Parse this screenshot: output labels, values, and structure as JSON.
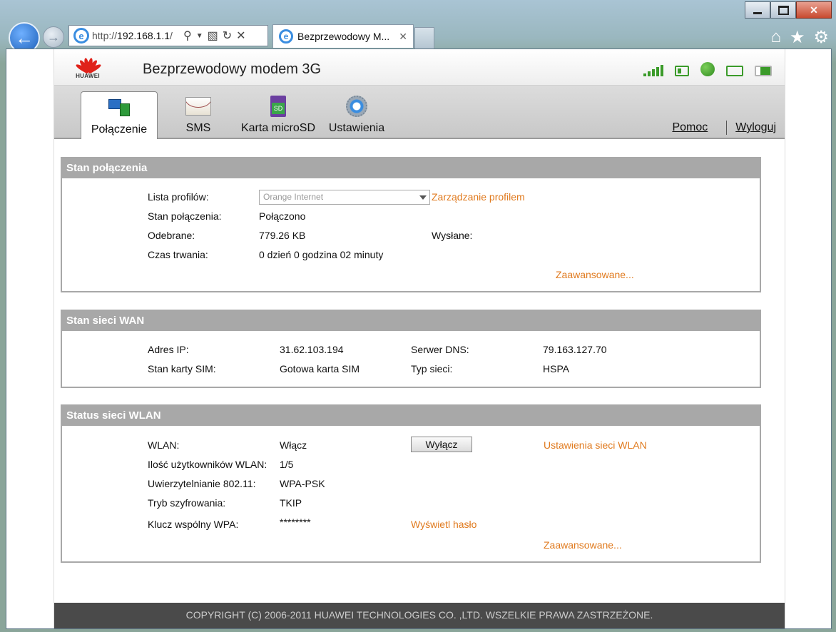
{
  "browser": {
    "url": "http://192.168.1.1/",
    "url_host": "192.168.1.1",
    "tab_title": "Bezprzewodowy M...",
    "tab_close": "✕"
  },
  "header": {
    "brand": "HUAWEI",
    "title": "Bezprzewodowy modem 3G"
  },
  "nav": {
    "tabs": [
      {
        "label": "Połączenie",
        "icon": "connection-icon",
        "active": true
      },
      {
        "label": "SMS",
        "icon": "envelope-icon"
      },
      {
        "label": "Karta microSD",
        "icon": "sd-card-icon"
      },
      {
        "label": "Ustawienia",
        "icon": "gear-icon"
      }
    ],
    "help": "Pomoc",
    "logout": "Wyloguj"
  },
  "connection": {
    "title": "Stan połączenia",
    "profile_label": "Lista profilów:",
    "profile_value": "Orange Internet",
    "profile_manage": "Zarządzanie profilem",
    "state_label": "Stan połączenia:",
    "state_value": "Połączono",
    "received_label": "Odebrane:",
    "received_value": "779.26 KB",
    "sent_label": "Wysłane:",
    "duration_label": "Czas trwania:",
    "duration_value": "0 dzień 0 godzina 02 minuty",
    "advanced": "Zaawansowane..."
  },
  "wan": {
    "title": "Stan sieci WAN",
    "ip_label": "Adres IP:",
    "ip_value": "31.62.103.194",
    "dns_label": "Serwer DNS:",
    "dns_value": "79.163.127.70",
    "sim_label": "Stan karty SIM:",
    "sim_value": "Gotowa karta SIM",
    "net_label": "Typ sieci:",
    "net_value": "HSPA"
  },
  "wlan": {
    "title": "Status sieci WLAN",
    "wlan_label": "WLAN:",
    "wlan_value": "Włącz",
    "toggle_button": "Wyłącz",
    "settings_link": "Ustawienia sieci WLAN",
    "users_label": "Ilość użytkowników WLAN:",
    "users_value": "1/5",
    "auth_label": "Uwierzytelnianie 802.11:",
    "auth_value": "WPA-PSK",
    "enc_label": "Tryb szyfrowania:",
    "enc_value": "TKIP",
    "key_label": "Klucz wspólny WPA:",
    "key_value": "********",
    "show_password": "Wyświetl hasło",
    "advanced": "Zaawansowane..."
  },
  "footer": {
    "copyright": "COPYRIGHT (C) 2006-2011 HUAWEI TECHNOLOGIES CO. ,LTD. WSZELKIE PRAWA ZASTRZEŻONE."
  },
  "colors": {
    "accent_orange": "#e07a1e",
    "status_green": "#3b9b2a",
    "panel_header_gray": "#a8a8a8",
    "footer_dark": "#4a4a4a"
  }
}
